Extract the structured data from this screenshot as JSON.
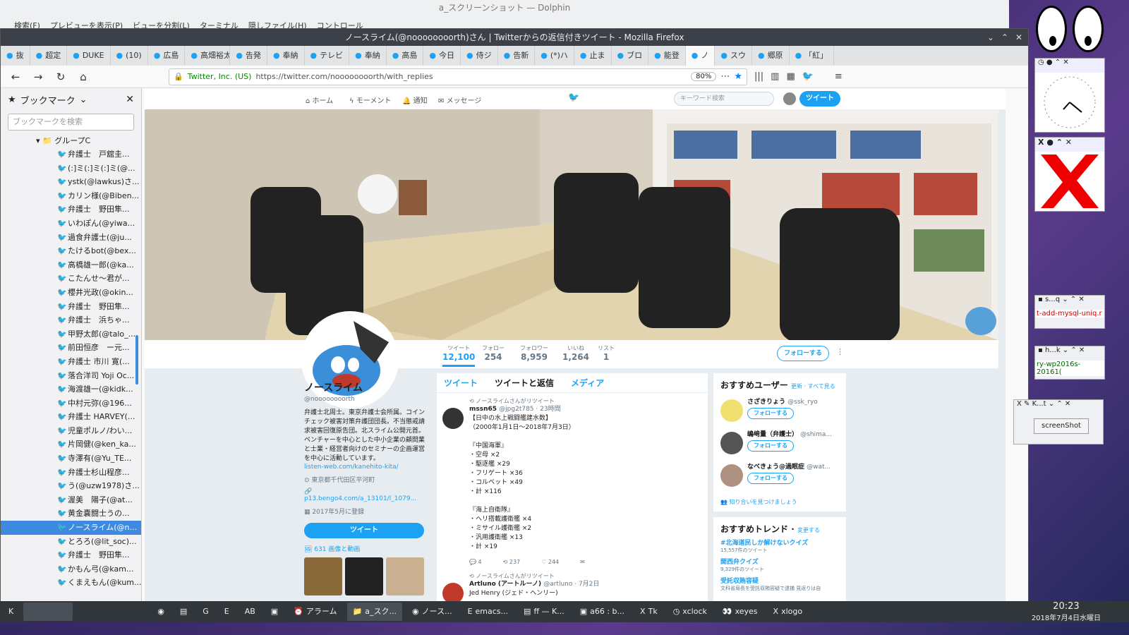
{
  "dolphin": {
    "title": "a_スクリーンショット — Dolphin",
    "toolbar": [
      "検索(F)",
      "プレビューを表示(P)",
      "ビューを分割(L)",
      "ターミナル",
      "隠しファイル(H)",
      "コントロール"
    ]
  },
  "firefox": {
    "title": "ノースライム(@noooooooorth)さん | Twitterからの返信付きツイート - Mozilla Firefox",
    "tabs": [
      "抜",
      "超定",
      "DUKE",
      "(10)",
      "広島",
      "高畑裕太",
      "告発",
      "奉納",
      "テレビ",
      "奉納",
      "高島",
      "今日",
      "侍ジ",
      "告新",
      "(*)ハ",
      "止ま",
      "ブロ",
      "能登",
      "ノ",
      "スウ",
      "郷原",
      "「紅」"
    ],
    "url": {
      "security": "Twitter, Inc. (US)",
      "address": "https://twitter.com/noooooooorth/with_replies",
      "zoom": "80%"
    }
  },
  "sidebar": {
    "title": "ブックマーク",
    "search_placeholder": "ブックマークを検索",
    "group": "グループC",
    "items": [
      "弁護士　戸舘圭...",
      "(:]ミ(:]ミ(:]ミ(@...",
      "ystk(@lawkus)さ...",
      "カリン様(@Biben...",
      "弁護士　野田隼...",
      "いわぽん(@yiwa...",
      "過食弁護士(@ju...",
      "たけるbot(@bex...",
      "高橋雄一郎(@ka...",
      "こたんせ～君が...",
      "櫻井光政(@okin...",
      "弁護士　野田隼...",
      "弁護士　浜ちゃ...",
      "甲野太郎(@talo_...",
      "前田恒彦　ー元...",
      "弁護士 市川 寛(...",
      "落合洋司 Yoji Oc...",
      "海渡雄一(@kidk...",
      "中村元弥(@196...",
      "弁護士 HARVEY(...",
      "児童ポルノ/わい...",
      "片岡健(@ken_ka...",
      "寺澤有(@Yu_TE...",
      "弁護士杉山程彦...",
      "う(@uzw1978)さ...",
      "渥美　陽子(@at...",
      "黄金嚢闘士うの...",
      "ノースライム(@n...",
      "とろろ(@lit_soc)...",
      "弁護士　野田隼...",
      "かもん弓(@kam...",
      "くまえもん(@kum..."
    ],
    "selected_index": 27
  },
  "twitter": {
    "nav": {
      "home": "ホーム",
      "moments": "モーメント",
      "notifications": "通知",
      "messages": "メッセージ",
      "search_placeholder": "キーワード検索",
      "tweet_button": "ツイート"
    },
    "stats": [
      {
        "label": "ツイート",
        "value": "12,100"
      },
      {
        "label": "フォロー",
        "value": "254"
      },
      {
        "label": "フォロワー",
        "value": "8,959"
      },
      {
        "label": "いいね",
        "value": "1,264"
      },
      {
        "label": "リスト",
        "value": "1"
      }
    ],
    "follow_button": "フォローする",
    "profile": {
      "name": "ノースライム",
      "handle": "@noooooooorth",
      "bio": "弁護士北周士。東京弁護士会所属。コインチェック被害対策弁護団団長。不当懲戒請求被害回復原告団。北スライム公開元首。ベンチャーを中心とした中小企業の顧問業と士業・経営者向けのセミナーの企画運営を中心に活動しています。",
      "bio_link": "listen-web.com/kanehito-kita/",
      "location": "東京都千代田区平河町",
      "website": "p13.bengo4.com/a_13101/l_1079...",
      "joined": "2017年5月に登録",
      "tweet_button": "ツイート",
      "media_link": "631 画像と動画"
    },
    "timeline": {
      "tabs": [
        "ツイート",
        "ツイートと返信",
        "メディア"
      ],
      "tweets": [
        {
          "retweet_note": "ノースライムさんがリツイート",
          "author": "mssn65",
          "handle": "@jpg2t785 · 23時間",
          "lines": [
            "【日中の水上戦闘艦建水数】",
            "（2000年1月1日〜2018年7月3日）",
            "",
            "『中国海軍』",
            "・空母 ×2",
            "・駆逐艦 ×29",
            "・フリゲート ×36",
            "・コルベット ×49",
            "・計 ×116",
            "",
            "『海上自衛隊』",
            "・ヘリ搭載護衛艦 ×4",
            "・ミサイル護衛艦 ×2",
            "・汎用護衛艦 ×13",
            "・計 ×19"
          ],
          "replies": "4",
          "retweets": "237",
          "likes": "244"
        },
        {
          "retweet_note": "ノースライムさんがリツイート",
          "author": "Artluno (アートルーノ)",
          "handle": "@artluno · 7月2日",
          "lines": [
            "Jed Henry (ジェド・ヘンリー)"
          ]
        }
      ]
    },
    "who_to_follow": {
      "title": "おすすめユーザー",
      "links": "更新 · すべて見る",
      "users": [
        {
          "name": "さざきりょう",
          "handle": "@ssk_ryo",
          "button": "フォローする"
        },
        {
          "name": "嶋﨑量（弁護士）",
          "handle": "@shima...",
          "button": "フォローする"
        },
        {
          "name": "なべきょう@過眠症",
          "handle": "@wat...",
          "button": "フォローする"
        }
      ],
      "find_friends": "知り合いを見つけましょう"
    },
    "trends": {
      "title": "おすすめトレンド",
      "change": "変更する",
      "items": [
        {
          "name": "#北海道民しか解けないクイズ",
          "count": "15,557件のツイート"
        },
        {
          "name": "関西弁クイズ",
          "count": "9,329件のツイート"
        },
        {
          "name": "受託収賄容疑",
          "count": "文科省局長を受託収賄容疑で逮捕 見返りは自"
        }
      ]
    }
  },
  "desktop": {
    "xlogo_title": "X",
    "emacs1": "t-add-mysql-uniq.r",
    "emacs2": "ry-wp2016s-20161(",
    "tk_button": "screenShot"
  },
  "taskbar": {
    "items": [
      "アラーム",
      "a_スク...",
      "ノース...",
      "emacs...",
      "ff — K...",
      "a66 : b...",
      "Tk",
      "xclock",
      "xeyes",
      "xlogo"
    ],
    "time": "20:23",
    "date": "2018年7月4日水曜日"
  }
}
